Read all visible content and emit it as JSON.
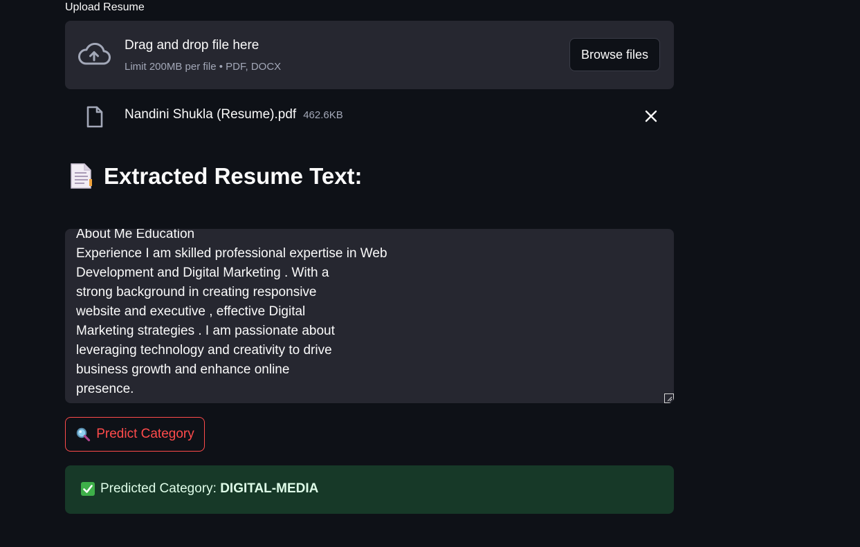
{
  "uploader": {
    "label": "Upload Resume",
    "drop_title": "Drag and drop file here",
    "drop_limit": "Limit 200MB per file • PDF, DOCX",
    "browse_label": "Browse files"
  },
  "uploaded_file": {
    "name": "Nandini Shukla (Resume).pdf",
    "size": "462.6KB"
  },
  "section": {
    "title": "Extracted Resume Text:",
    "icon": "page-facing-up-icon"
  },
  "resume_text": "About Me Education\nExperience I am skilled professional expertise in Web\nDevelopment and Digital Marketing . With a\nstrong background in creating responsive\nwebsite and executive , effective Digital\nMarketing strategies . I am passionate about\nleveraging technology and creativity to drive\nbusiness growth and enhance online\npresence.",
  "predict_button": {
    "label": "Predict Category",
    "icon": "magnifying-glass-icon"
  },
  "result": {
    "prefix": "Predicted Category:",
    "value": "DIGITAL-MEDIA",
    "icon": "check-mark-icon"
  },
  "colors": {
    "background": "#0e1117",
    "surface": "#262730",
    "accent": "#ff4b4b",
    "success_bg": "#173928",
    "muted_text": "#a3a8b8"
  }
}
